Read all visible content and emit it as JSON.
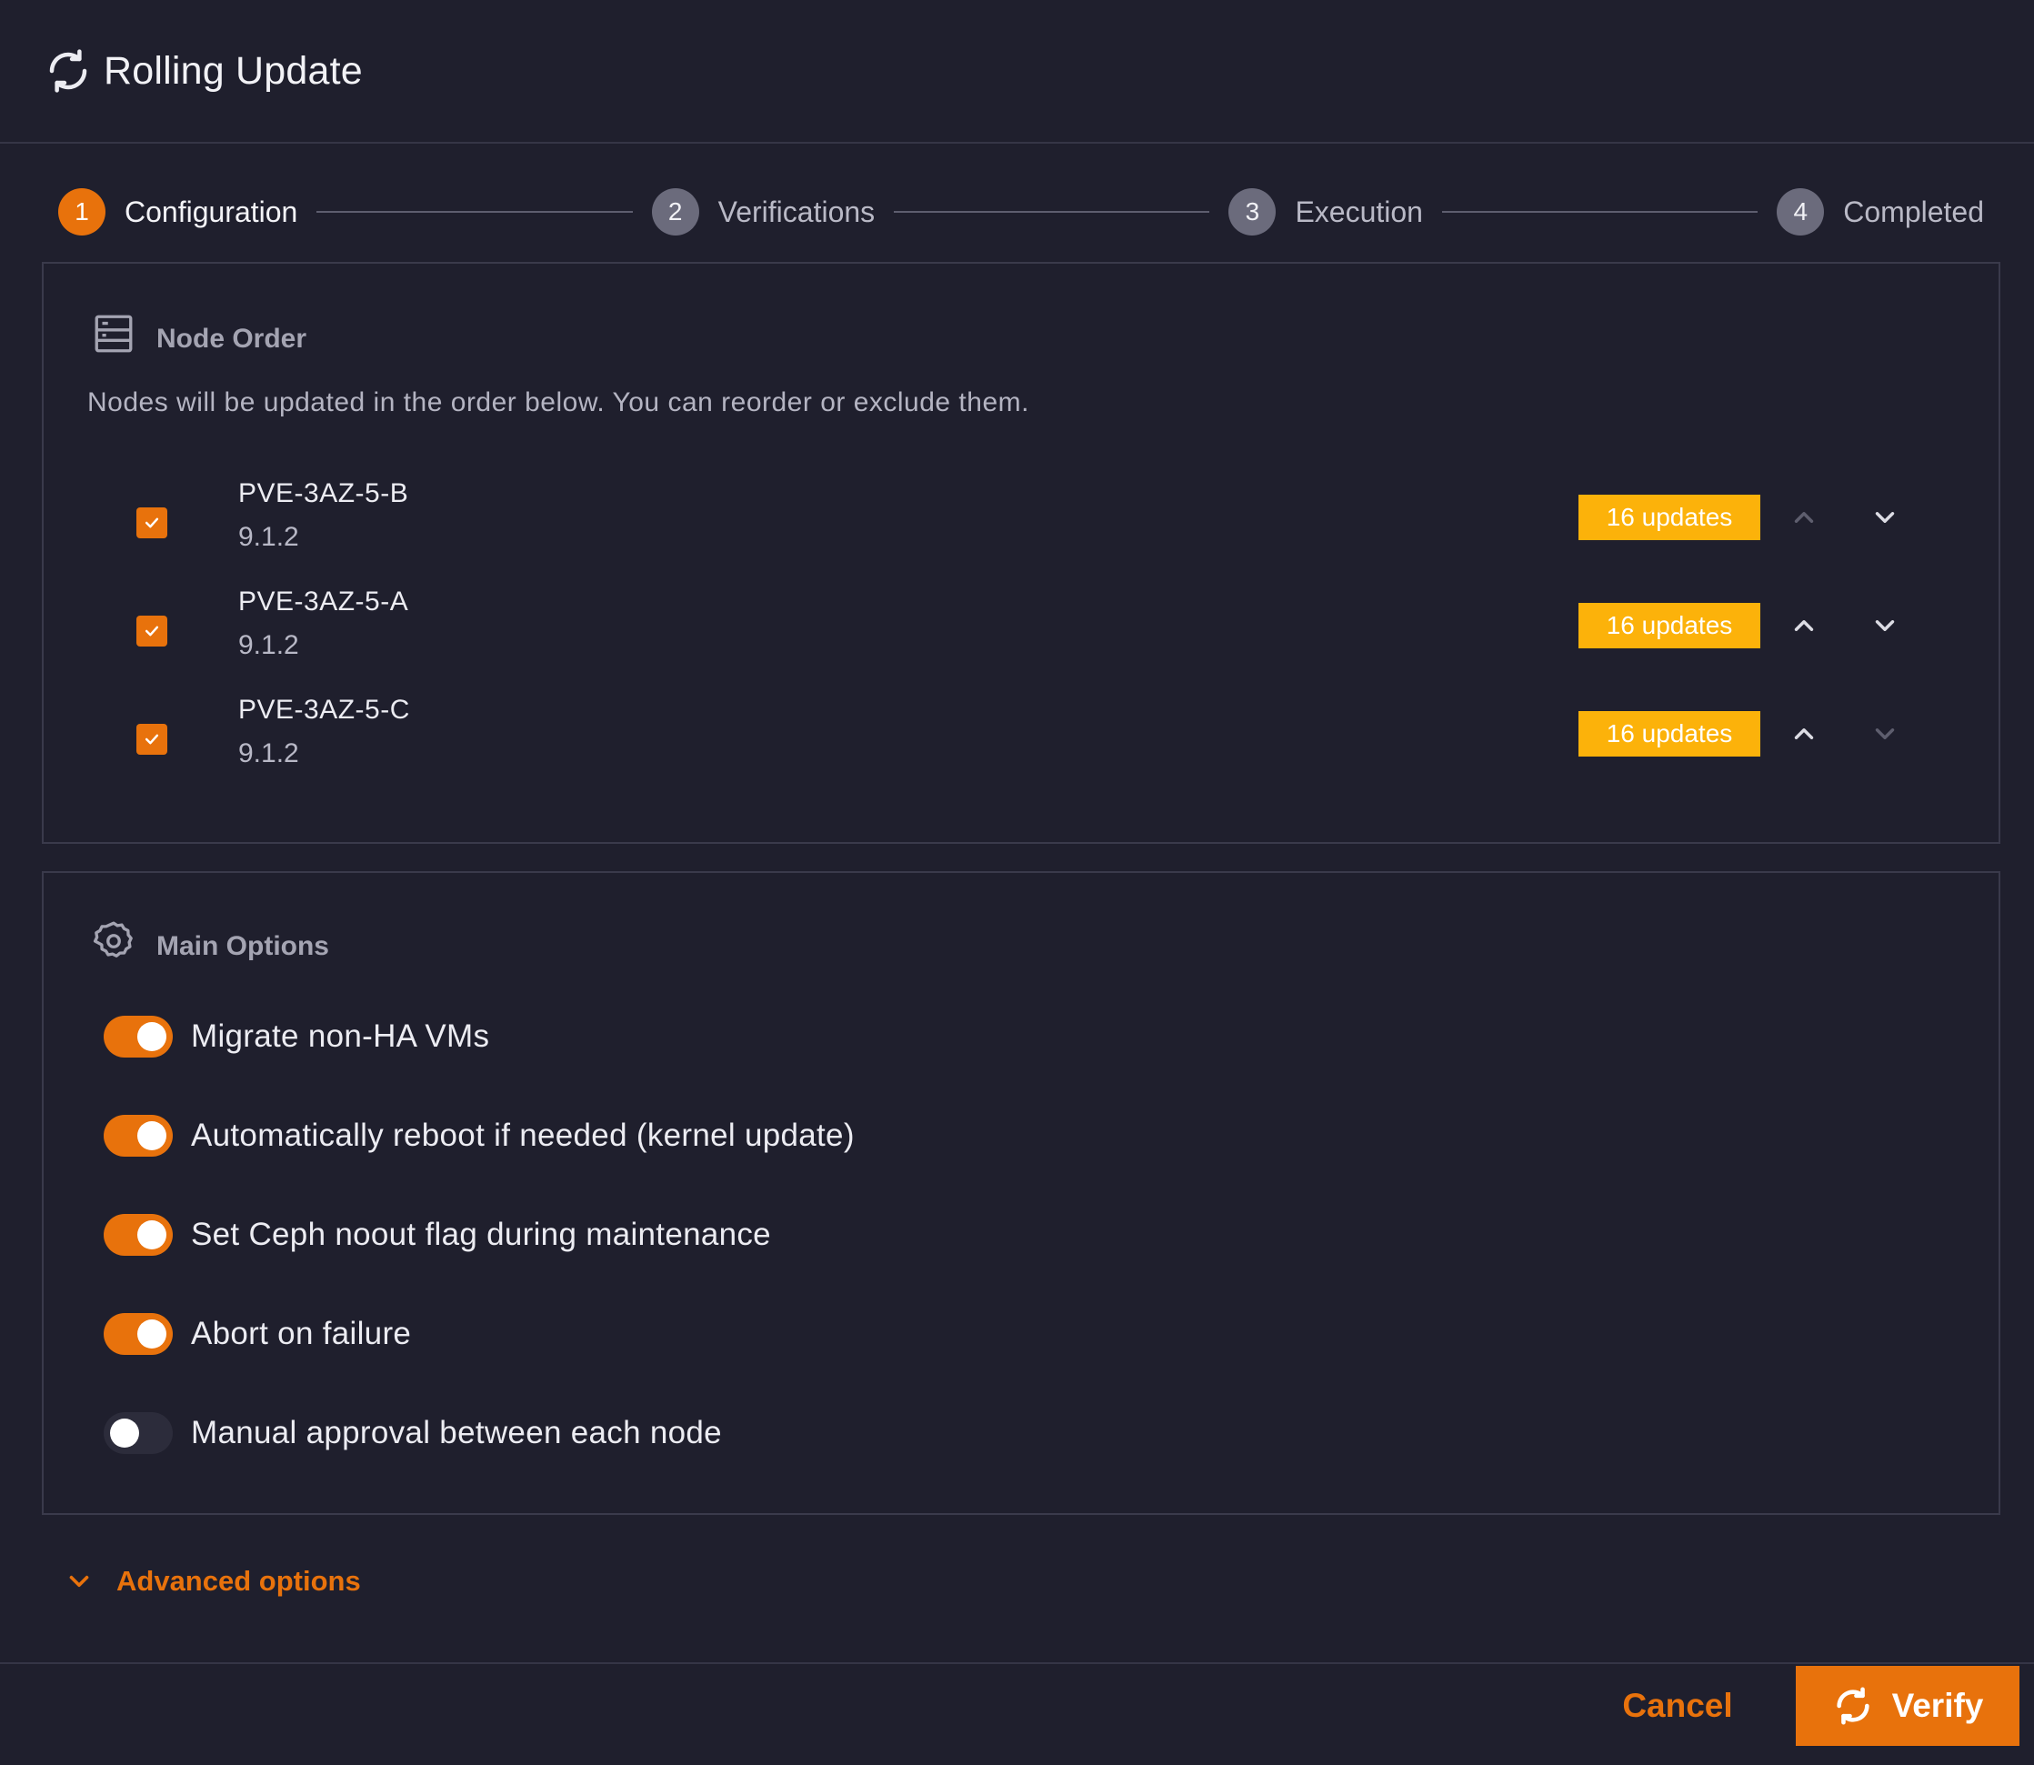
{
  "dialog": {
    "title": "Rolling Update",
    "title_icon": "sync-icon"
  },
  "stepper": {
    "steps": [
      {
        "number": "1",
        "label": "Configuration",
        "active": true
      },
      {
        "number": "2",
        "label": "Verifications",
        "active": false
      },
      {
        "number": "3",
        "label": "Execution",
        "active": false
      },
      {
        "number": "4",
        "label": "Completed",
        "active": false
      }
    ]
  },
  "node_order": {
    "title": "Node Order",
    "icon": "server-icon",
    "description": "Nodes will be updated in the order below. You can reorder or exclude them.",
    "nodes": [
      {
        "name": "PVE-3AZ-5-B",
        "version": "9.1.2",
        "updates": "16 updates",
        "checked": true,
        "can_move_up": false,
        "can_move_down": true
      },
      {
        "name": "PVE-3AZ-5-A",
        "version": "9.1.2",
        "updates": "16 updates",
        "checked": true,
        "can_move_up": true,
        "can_move_down": true
      },
      {
        "name": "PVE-3AZ-5-C",
        "version": "9.1.2",
        "updates": "16 updates",
        "checked": true,
        "can_move_up": true,
        "can_move_down": false
      }
    ]
  },
  "main_options": {
    "title": "Main Options",
    "icon": "gear-icon",
    "options": [
      {
        "label": "Migrate non-HA VMs",
        "enabled": true
      },
      {
        "label": "Automatically reboot if needed (kernel update)",
        "enabled": true
      },
      {
        "label": "Set Ceph noout flag during maintenance",
        "enabled": true
      },
      {
        "label": "Abort on failure",
        "enabled": true
      },
      {
        "label": "Manual approval between each node",
        "enabled": false
      }
    ]
  },
  "advanced": {
    "label": "Advanced options",
    "icon": "chevron-down-icon"
  },
  "footer": {
    "cancel_label": "Cancel",
    "verify_label": "Verify",
    "verify_icon": "sync-icon"
  },
  "colors": {
    "accent": "#e8720c",
    "badge": "#fcb20a",
    "background": "#1f1f2d"
  }
}
